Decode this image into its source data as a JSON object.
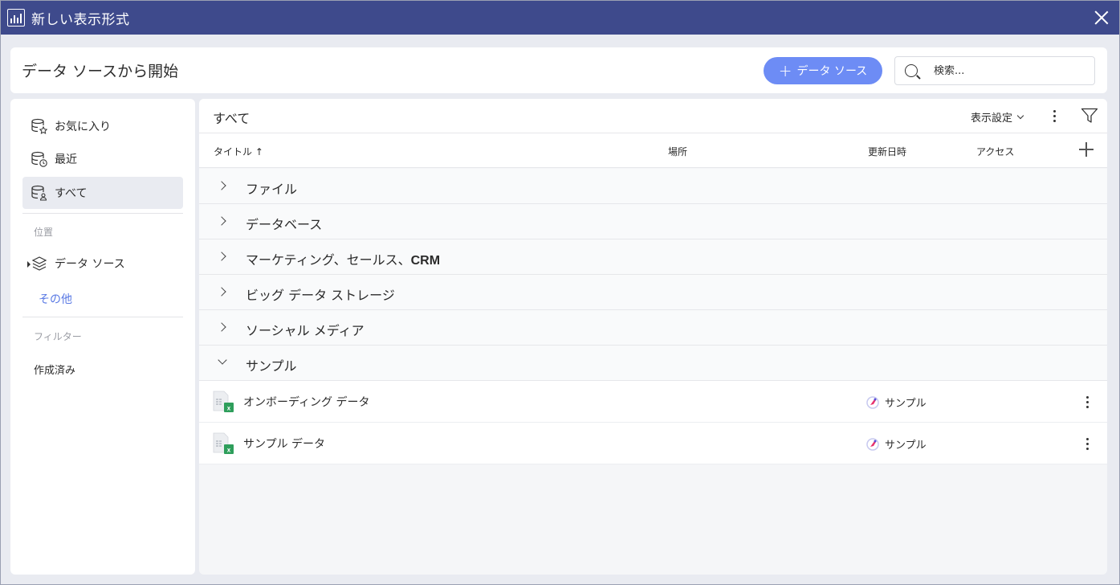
{
  "window": {
    "title": "新しい表示形式"
  },
  "header": {
    "heading": "データ ソースから開始",
    "add_button": "データ ソース",
    "search_placeholder": "検索..."
  },
  "sidebar": {
    "items": [
      {
        "label": "お気に入り",
        "icon": "database-star-icon"
      },
      {
        "label": "最近",
        "icon": "database-clock-icon"
      },
      {
        "label": "すべて",
        "icon": "database-user-icon"
      }
    ],
    "location_label": "位置",
    "data_sources": "データ ソース",
    "other": "その他",
    "filter_label": "フィルター",
    "created": "作成済み"
  },
  "main": {
    "section_title": "すべて",
    "view_settings": "表示設定",
    "columns": {
      "title": "タイトル",
      "location": "場所",
      "updated": "更新日時",
      "access": "アクセス"
    },
    "groups": [
      {
        "label": "ファイル",
        "open": false
      },
      {
        "label": "データベース",
        "open": false
      },
      {
        "label_prefix": "マーケティング、セールス、",
        "label_bold": "CRM",
        "open": false
      },
      {
        "label": "ビッグ データ ストレージ",
        "open": false
      },
      {
        "label": "ソーシャル メディア",
        "open": false
      },
      {
        "label": "サンプル",
        "open": true
      }
    ],
    "files": [
      {
        "name": "オンボーディング データ",
        "location": "サンプル"
      },
      {
        "name": "サンプル データ",
        "location": "サンプル"
      }
    ]
  },
  "colors": {
    "titlebar": "#3e4a8c",
    "accent": "#6d8cf5",
    "link": "#5878e4"
  }
}
